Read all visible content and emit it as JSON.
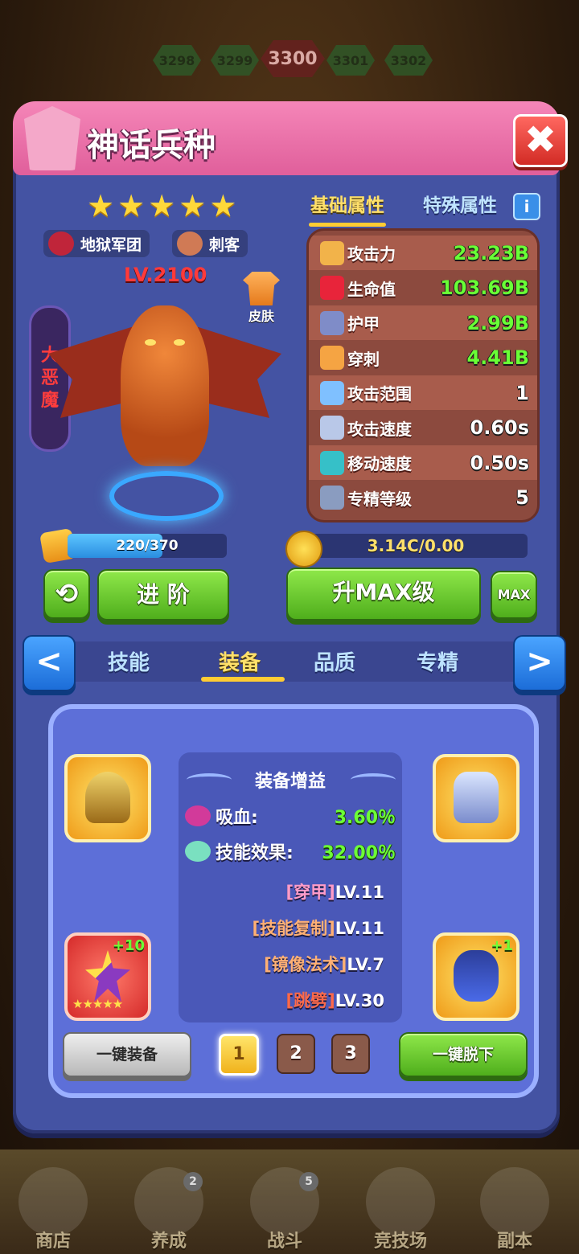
{
  "stages": [
    "3298",
    "3299",
    "3300",
    "3301",
    "3302"
  ],
  "header": {
    "title": "神话兵种",
    "close_label": "✖"
  },
  "hero": {
    "stars": 5,
    "faction": "地狱军团",
    "class": "刺客",
    "level": "LV.2100",
    "name": "大恶魔",
    "skin_label": "皮肤"
  },
  "stat_tabs": {
    "basic": "基础属性",
    "special": "特殊属性",
    "info": "i"
  },
  "stats": [
    {
      "name": "攻击力",
      "value": "23.23B",
      "color": "green",
      "icon_color": "#f2b34a"
    },
    {
      "name": "生命值",
      "value": "103.69B",
      "color": "green",
      "icon_color": "#e8243a"
    },
    {
      "name": "护甲",
      "value": "2.99B",
      "color": "green",
      "icon_color": "#7f8cc8"
    },
    {
      "name": "穿刺",
      "value": "4.41B",
      "color": "green",
      "icon_color": "#f5a443"
    },
    {
      "name": "攻击范围",
      "value": "1",
      "color": "white",
      "icon_color": "#7fc0ff"
    },
    {
      "name": "攻击速度",
      "value": "0.60s",
      "color": "white",
      "icon_color": "#b9c8e8"
    },
    {
      "name": "移动速度",
      "value": "0.50s",
      "color": "white",
      "icon_color": "#36c0c8"
    },
    {
      "name": "专精等级",
      "value": "5",
      "color": "white",
      "icon_color": "#8a9cc0"
    }
  ],
  "exp": {
    "text": "220/370",
    "fraction": 0.595
  },
  "gold": {
    "text": "3.14C/0.00"
  },
  "buttons": {
    "advance": "进 阶",
    "upgrade": "升MAX级",
    "max": "MAX",
    "refresh": "⟲"
  },
  "category_tabs": [
    "技能",
    "装备",
    "品质",
    "专精"
  ],
  "active_category": "装备",
  "arrows": {
    "left": "<",
    "right": ">"
  },
  "equipment": {
    "slot_helmet_plus": "",
    "slot_wand_plus": "+10",
    "slot_wand_stars": "★★★★★",
    "slot_belt_plus": "+1",
    "bonus_title": "装备增益",
    "bonuses": [
      {
        "name": "吸血:",
        "value": "3.60％"
      },
      {
        "name": "技能效果:",
        "value": "32.00％"
      }
    ],
    "sets": [
      {
        "name": "[穿甲]",
        "level": "LV.11"
      },
      {
        "name": "[技能复制]",
        "level": "LV.11"
      },
      {
        "name": "[镜像法术]",
        "level": "LV.7"
      },
      {
        "name": "[跳劈]",
        "level": "LV.30"
      }
    ],
    "equip_all": "一键装备",
    "unequip_all": "一键脱下",
    "pages": [
      "1",
      "2",
      "3"
    ],
    "active_page": "1"
  },
  "nav": [
    {
      "label": "商店",
      "badge": ""
    },
    {
      "label": "养成",
      "badge": "2"
    },
    {
      "label": "战斗",
      "badge": "5"
    },
    {
      "label": "竞技场",
      "badge": ""
    },
    {
      "label": "副本",
      "badge": ""
    }
  ]
}
